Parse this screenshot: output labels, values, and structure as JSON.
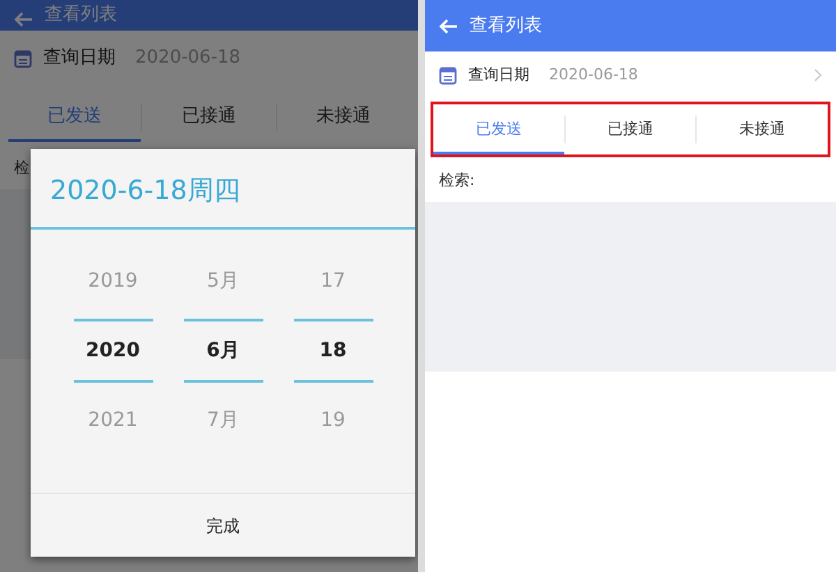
{
  "screens": [
    {
      "title": "查看列表",
      "date_label": "查询日期",
      "date_value": "2020-06-18",
      "dimmed": true,
      "tabs": [
        {
          "label": "已发送",
          "selected": true
        },
        {
          "label": "已接通",
          "selected": false
        },
        {
          "label": "未接通",
          "selected": false
        }
      ],
      "search_label": "检",
      "picker": {
        "title": "2020-6-18周四",
        "columns": [
          {
            "above": "2019",
            "value": "2020",
            "below": "2021"
          },
          {
            "above": "5月",
            "value": "6月",
            "below": "7月"
          },
          {
            "above": "17",
            "value": "18",
            "below": "19"
          }
        ],
        "done": "完成"
      }
    },
    {
      "title": "查看列表",
      "date_label": "查询日期",
      "date_value": "2020-06-18",
      "show_chevron": true,
      "tabs_highlighted": true,
      "tabs": [
        {
          "label": "已发送",
          "selected": true
        },
        {
          "label": "已接通",
          "selected": false
        },
        {
          "label": "未接通",
          "selected": false
        }
      ],
      "search_label": "检索:"
    }
  ]
}
